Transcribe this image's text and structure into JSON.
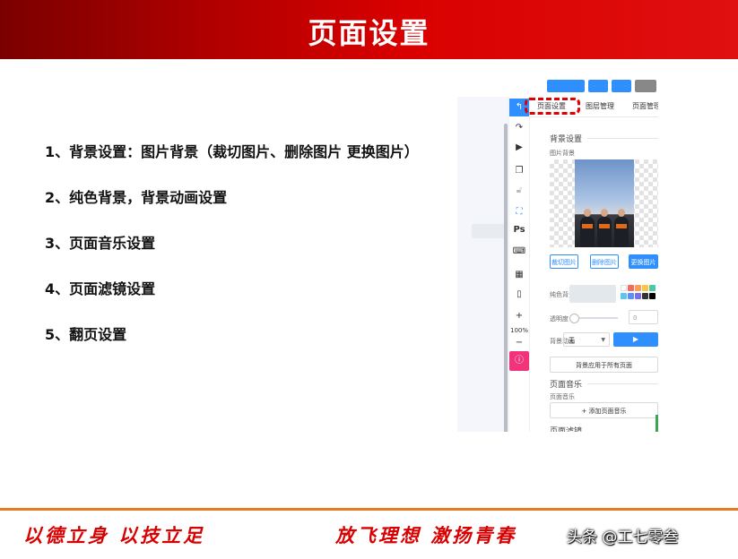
{
  "banner": {
    "title": "页面设置",
    "color": "#d00000"
  },
  "list": [
    "1、背景设置：图片背景（裁切图片、删除图片 更换图片）",
    "2、纯色背景，背景动画设置",
    "3、页面音乐设置",
    "4、页面滤镜设置",
    "5、翻页设置"
  ],
  "screenshot": {
    "toolbar": {
      "zoom_plus": "+",
      "zoom_level": "100%",
      "zoom_minus": "−",
      "ps_label": "Ps"
    },
    "tabs": [
      "页面设置",
      "图层管理",
      "页面管理"
    ],
    "background_section": {
      "title": "背景设置",
      "image_label": "图片背景",
      "crop_button": "裁切图片",
      "delete_button": "删除图片",
      "replace_button": "更换图片",
      "solid_label": "纯色背景",
      "opacity_label": "透明度",
      "opacity_value": "0",
      "animation_label": "背景动画",
      "animation_value": "无",
      "apply_all_button": "背景应用于所有页面"
    },
    "music_section": {
      "title": "页面音乐",
      "music_label": "页面音乐",
      "add_music_button": "+  添加页面音乐"
    },
    "filter_section": {
      "title": "页面滤镜"
    },
    "swatches": [
      "#ffffff",
      "#f36b5b",
      "#f7a05a",
      "#f6c64a",
      "#4cc9a3",
      "#5fc4f0",
      "#5b8ff9",
      "#7b6fe8",
      "#333333",
      "#000000"
    ],
    "accent_color": "#2f8fff"
  },
  "footer": {
    "slogan_left": "以德立身 以技立足",
    "slogan_right": "放飞理想 激扬青春",
    "watermark": "头条 @工七零叁",
    "accent_color": "#d80000"
  }
}
